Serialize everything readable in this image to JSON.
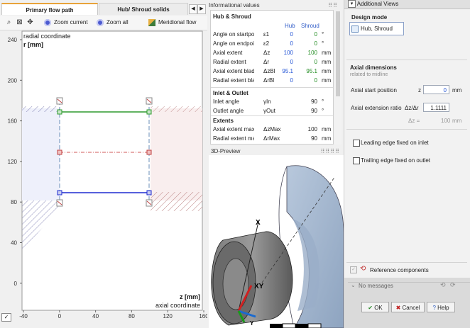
{
  "left": {
    "tabs": [
      {
        "label": "Primary flow path"
      },
      {
        "label": "Hub/ Shroud solids"
      }
    ],
    "toolbar": {
      "zoom_current": "Zoom current",
      "zoom_all": "Zoom all",
      "meridional_flow": "Meridional flow"
    },
    "plot": {
      "y_title": "radial coordinate",
      "y_label": "r [mm]",
      "x_label": "z [mm]",
      "x_title": "axial coordinate",
      "y_ticks": [
        "240",
        "200",
        "160",
        "120",
        "80",
        "40",
        "0"
      ],
      "x_ticks": [
        "-40",
        "0",
        "40",
        "80",
        "120",
        "160"
      ],
      "colors": {
        "hub": "#1e2bd0",
        "shroud": "#2e9a2e",
        "midline": "#d05a5a",
        "inlet": "#7a9ac0",
        "hatch": "#7a7ab4"
      }
    }
  },
  "info": {
    "header": "Informational values",
    "sections": {
      "hub_shroud": "Hub & Shroud",
      "inlet_outlet": "Inlet & Outlet",
      "extents": "Extents"
    },
    "col_hub": "Hub",
    "col_shroud": "Shroud",
    "hub_rows": [
      {
        "label": "Angle on startpo",
        "sym": "ε1",
        "v1": "0",
        "v2": "0",
        "unit": "°"
      },
      {
        "label": "Angle on endpoi",
        "sym": "ε2",
        "v1": "0",
        "v2": "0",
        "unit": "°"
      },
      {
        "label": "Axial extent",
        "sym": "Δz",
        "v1": "100",
        "v2": "100",
        "unit": "mm"
      },
      {
        "label": "Radial extent",
        "sym": "Δr",
        "v1": "0",
        "v2": "0",
        "unit": "mm"
      },
      {
        "label": "Axial extent blad",
        "sym": "ΔzBl",
        "v1": "95.1",
        "v2": "95.1",
        "unit": "mm"
      },
      {
        "label": "Radial extent bla",
        "sym": "ΔrBl",
        "v1": "0",
        "v2": "0",
        "unit": "mm"
      }
    ],
    "io_rows": [
      {
        "label": "Inlet angle",
        "sym": "γIn",
        "v": "90",
        "unit": "°"
      },
      {
        "label": "Outlet angle",
        "sym": "γOut",
        "v": "90",
        "unit": "°"
      }
    ],
    "ext_rows": [
      {
        "label": "Axial extent max.",
        "sym": "ΔzMax",
        "v": "100",
        "unit": "mm"
      },
      {
        "label": "Radial extent max.",
        "sym": "ΔrMax",
        "v": "90",
        "unit": "mm"
      }
    ]
  },
  "preview": {
    "header": "3D-Preview",
    "axis_x": "X",
    "axis_y": "Y",
    "axis_xy": "XY"
  },
  "right": {
    "additional_views": "Additional Views",
    "design_mode_title": "Design mode",
    "design_mode_value": "Hub, Shroud",
    "axial_dimensions_title": "Axial dimensions",
    "axial_dimensions_sub": "related to midline",
    "axial_start_label": "Axial start position",
    "axial_start_sym": "z",
    "axial_start_value": "0",
    "axial_start_unit": "mm",
    "axial_ratio_label": "Axial extension ratio",
    "axial_ratio_sym": "Δz/Δr",
    "axial_ratio_value": "1.1111",
    "dz_sym": "Δz =",
    "dz_value": "100",
    "dz_unit": "mm",
    "leading_edge": "Leading edge fixed on inlet",
    "trailing_edge": "Trailing edge fixed on outlet",
    "reference_components": "Reference components",
    "no_messages": "No messages",
    "ok": "OK",
    "cancel": "Cancel",
    "help": "Help"
  }
}
